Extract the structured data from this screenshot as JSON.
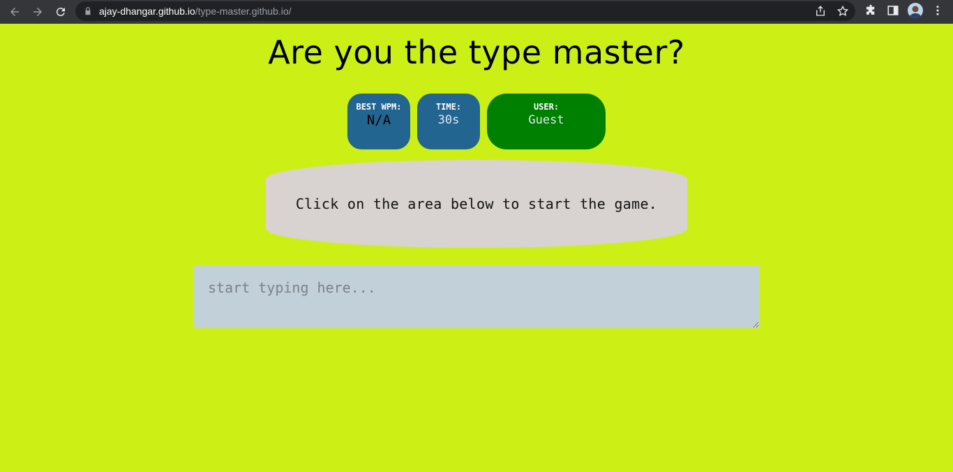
{
  "browser": {
    "url_host": "ajay-dhangar.github.io",
    "url_path": "/type-master.github.io/",
    "icons": [
      "back-icon",
      "forward-icon",
      "reload-icon",
      "lock-icon",
      "share-icon",
      "star-icon",
      "extensions-icon",
      "side-panel-icon",
      "avatar",
      "menu-icon"
    ]
  },
  "page": {
    "title": "Are you the type master?",
    "stats": {
      "best_wpm_label": "BEST WPM:",
      "best_wpm_value": "N/A",
      "time_label": "TIME:",
      "time_value": "30s",
      "user_label": "USER:",
      "user_value": "Guest"
    },
    "message": "Click on the area below to start the game.",
    "input": {
      "placeholder": "start typing here...",
      "value": ""
    }
  },
  "colors": {
    "background": "#ccf016",
    "stat_blue": "#236591",
    "stat_green": "#008000",
    "message_bg": "#d8d2d0",
    "input_bg": "#c2d0d9"
  }
}
